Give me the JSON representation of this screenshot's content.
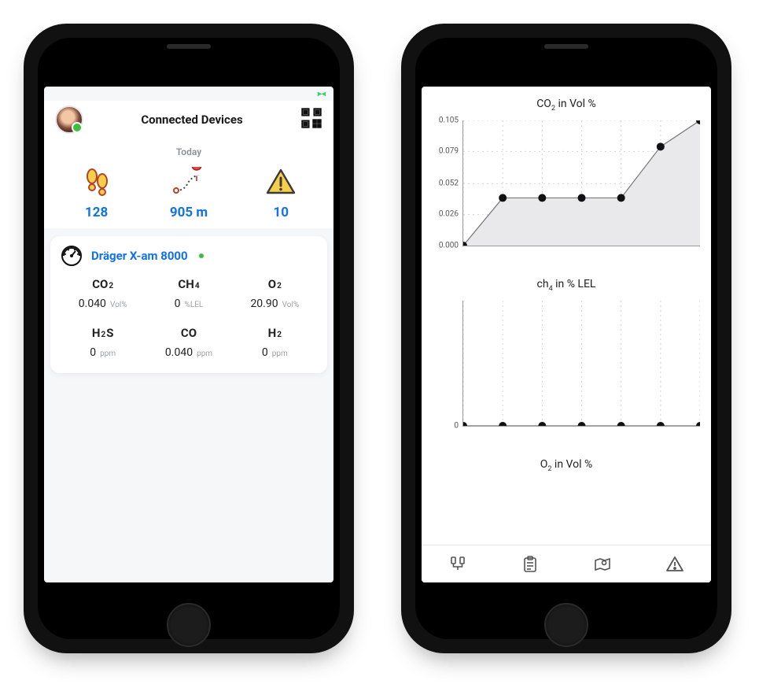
{
  "left": {
    "status": {
      "charging_indicator": "▸◂"
    },
    "header": {
      "title": "Connected Devices"
    },
    "today_label": "Today",
    "stats": {
      "steps": {
        "value": "128"
      },
      "distance": {
        "value": "905 m"
      },
      "alerts": {
        "value": "10"
      }
    },
    "device": {
      "name": "Dräger X-am 8000",
      "readings": [
        {
          "label": "CO",
          "sub": "2",
          "value": "0.040",
          "unit": "Vol%"
        },
        {
          "label": "CH",
          "sub": "4",
          "value": "0",
          "unit": "%LEL"
        },
        {
          "label": "O",
          "sub": "2",
          "value": "20.90",
          "unit": "Vol%"
        },
        {
          "label": "H",
          "sub": "2",
          "tail": "S",
          "value": "0",
          "unit": "ppm"
        },
        {
          "label": "CO",
          "sub": "",
          "value": "0.040",
          "unit": "ppm"
        },
        {
          "label": "H",
          "sub": "2",
          "value": "0",
          "unit": "ppm"
        }
      ]
    }
  },
  "right": {
    "chart1": {
      "title_pre": "CO",
      "title_sub": "2",
      "title_post": " in Vol %"
    },
    "chart2": {
      "title_pre": "ch",
      "title_sub": "4",
      "title_post": "  in % LEL"
    },
    "chart3": {
      "title_pre": "O",
      "title_sub": "2",
      "title_post": " in Vol %"
    }
  },
  "chart_data": [
    {
      "type": "line",
      "title": "CO₂ in Vol %",
      "y_ticks": [
        0.0,
        0.026,
        0.052,
        0.079,
        0.105
      ],
      "y_tick_labels": [
        "0.000",
        "0.026",
        "0.052",
        "0.079",
        "0.105"
      ],
      "ylim": [
        0,
        0.105
      ],
      "x": [
        0,
        1,
        2,
        3,
        4,
        5,
        6
      ],
      "values": [
        0.0,
        0.04,
        0.04,
        0.04,
        0.04,
        0.083,
        0.105
      ],
      "ylabel": "Vol %"
    },
    {
      "type": "line",
      "title": "ch₄ in % LEL",
      "y_ticks": [
        0
      ],
      "y_tick_labels": [
        "0"
      ],
      "ylim": [
        0,
        1
      ],
      "x": [
        0,
        1,
        2,
        3,
        4,
        5,
        6
      ],
      "values": [
        0,
        0,
        0,
        0,
        0,
        0,
        0
      ],
      "ylabel": "% LEL"
    },
    {
      "type": "line",
      "title": "O₂ in Vol %",
      "y_ticks": [],
      "y_tick_labels": [],
      "ylim": [
        0,
        25
      ],
      "x": [],
      "values": [],
      "ylabel": "Vol %"
    }
  ]
}
